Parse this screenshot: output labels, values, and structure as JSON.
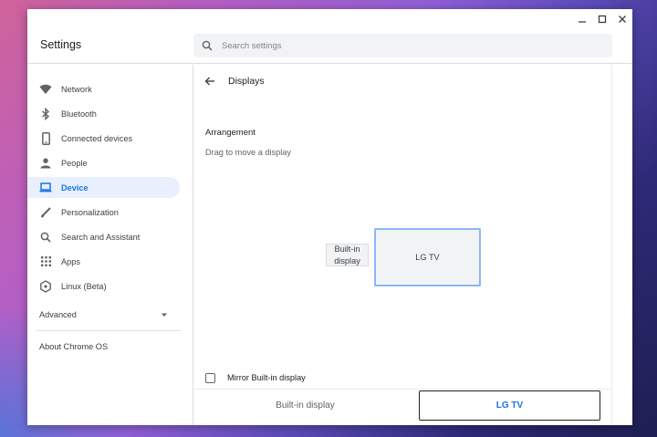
{
  "window": {
    "controls": {
      "minimize_icon": "minimize-icon",
      "maximize_icon": "maximize-icon",
      "close_icon": "close-icon"
    }
  },
  "header": {
    "title": "Settings",
    "search": {
      "placeholder": "Search settings",
      "value": ""
    }
  },
  "sidebar": {
    "items": [
      {
        "label": "Network",
        "icon": "wifi-icon"
      },
      {
        "label": "Bluetooth",
        "icon": "bluetooth-icon"
      },
      {
        "label": "Connected devices",
        "icon": "phone-icon"
      },
      {
        "label": "People",
        "icon": "person-icon"
      },
      {
        "label": "Device",
        "icon": "laptop-icon",
        "active": true
      },
      {
        "label": "Personalization",
        "icon": "brush-icon"
      },
      {
        "label": "Search and Assistant",
        "icon": "search-icon"
      },
      {
        "label": "Apps",
        "icon": "apps-grid-icon"
      },
      {
        "label": "Linux (Beta)",
        "icon": "linux-icon"
      }
    ],
    "advanced": "Advanced",
    "about": "About Chrome OS"
  },
  "main": {
    "page_title": "Displays",
    "arrangement": {
      "title": "Arrangement",
      "hint": "Drag to move a display",
      "displays": [
        {
          "label": "Built-in display"
        },
        {
          "label": "LG TV",
          "selected": true
        }
      ]
    },
    "mirror_label": "Mirror Built-in display",
    "mirror_checked": false,
    "tabs": [
      {
        "label": "Built-in display"
      },
      {
        "label": "LG TV",
        "selected": true
      }
    ]
  },
  "colors": {
    "accent": "#1a73e8",
    "active_bg": "#e8f0fe",
    "text": "#202124",
    "secondary_text": "#5f6368"
  }
}
